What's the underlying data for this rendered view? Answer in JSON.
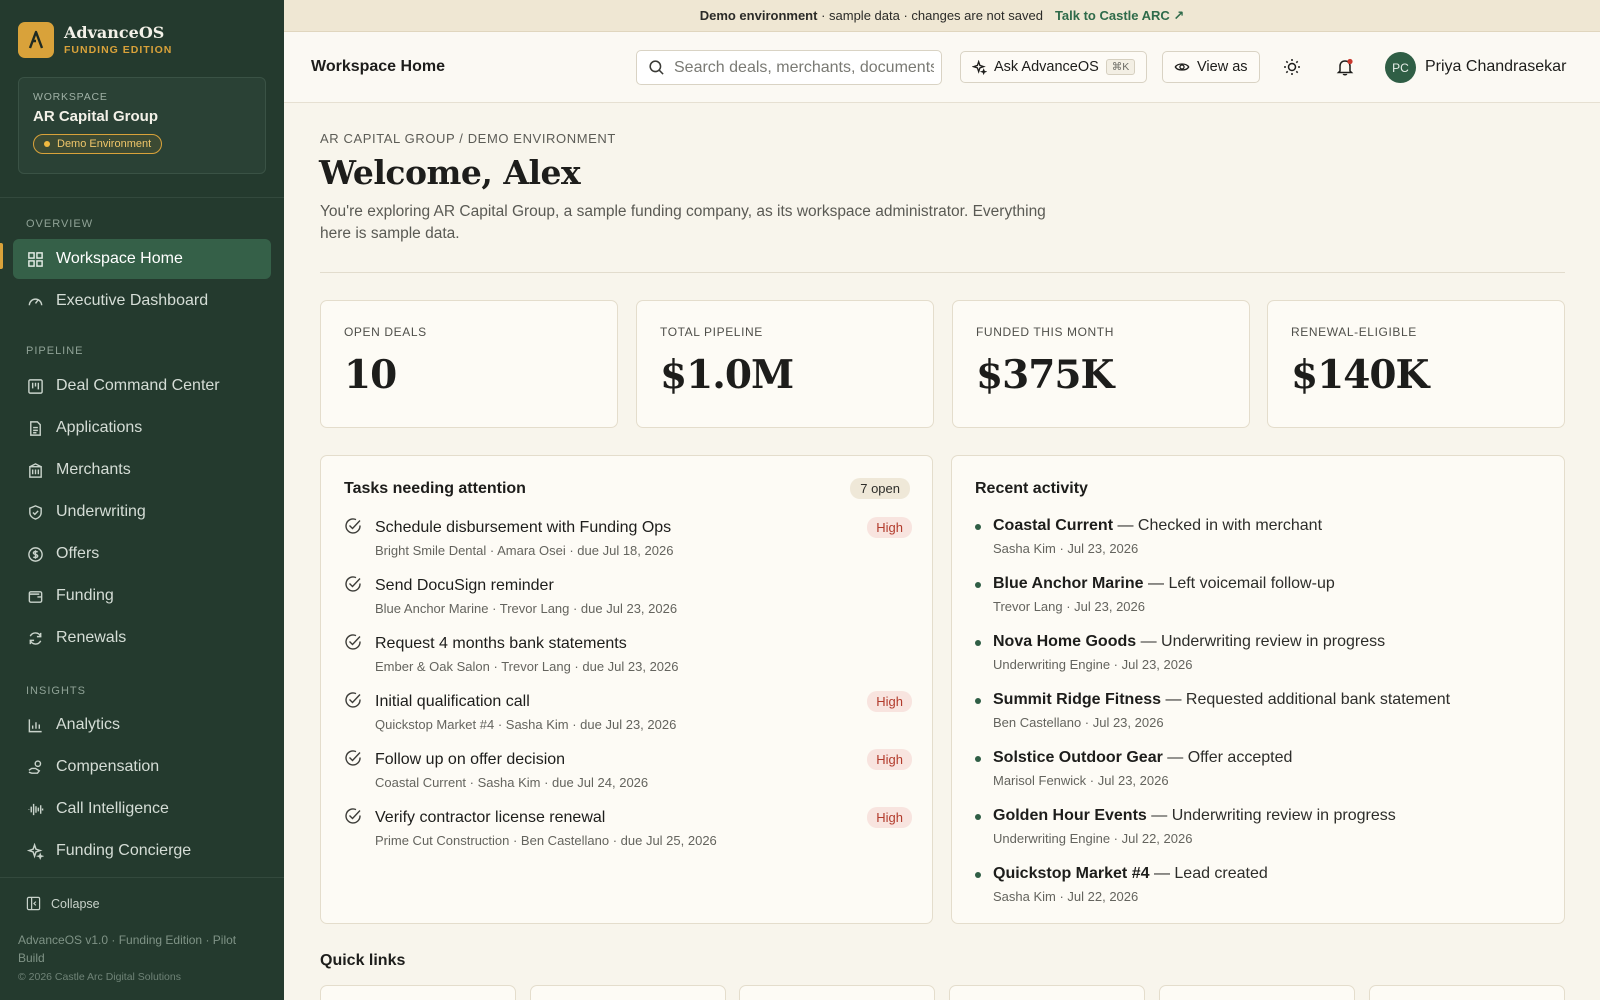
{
  "brand": {
    "name": "AdvanceOS",
    "sub": "FUNDING EDITION"
  },
  "workspace": {
    "label": "WORKSPACE",
    "name": "AR Capital Group",
    "badge": "Demo Environment"
  },
  "nav": {
    "overview_label": "OVERVIEW",
    "pipeline_label": "PIPELINE",
    "insights_label": "INSIGHTS",
    "overview": [
      "Workspace Home",
      "Executive Dashboard"
    ],
    "pipeline": [
      "Deal Command Center",
      "Applications",
      "Merchants",
      "Underwriting",
      "Offers",
      "Funding",
      "Renewals"
    ],
    "insights": [
      "Analytics",
      "Compensation",
      "Call Intelligence",
      "Funding Concierge"
    ],
    "collapse": "Collapse",
    "footer_version": "AdvanceOS v1.0 · Funding Edition · Pilot Build",
    "footer_copyright": "© 2026 Castle Arc Digital Solutions"
  },
  "banner": {
    "bold": "Demo environment",
    "rest": "· sample data · changes are not saved",
    "link": "Talk to Castle ARC ↗"
  },
  "header": {
    "title": "Workspace Home",
    "search_placeholder": "Search deals, merchants, documents",
    "ask_label": "Ask AdvanceOS",
    "ask_kbd": "⌘K",
    "view_as_label": "View as",
    "user_initials": "PC",
    "user_name": "Priya Chandrasekar"
  },
  "main": {
    "breadcrumb": "AR CAPITAL GROUP / DEMO ENVIRONMENT",
    "welcome": "Welcome, Alex",
    "intro": "You're exploring AR Capital Group, a sample funding company, as its workspace administrator. Everything here is sample data."
  },
  "stats": [
    {
      "label": "OPEN DEALS",
      "value": "10"
    },
    {
      "label": "TOTAL PIPELINE",
      "value": "$1.0M"
    },
    {
      "label": "FUNDED THIS MONTH",
      "value": "$375K"
    },
    {
      "label": "RENEWAL-ELIGIBLE",
      "value": "$140K"
    }
  ],
  "tasks": {
    "title": "Tasks needing attention",
    "badge": "7 open",
    "high_label": "High",
    "items": [
      {
        "title": "Schedule disbursement with Funding Ops",
        "meta": "Bright Smile Dental · Amara Osei · due Jul 18, 2026",
        "high": true
      },
      {
        "title": "Send DocuSign reminder",
        "meta": "Blue Anchor Marine · Trevor Lang · due Jul 23, 2026",
        "high": false
      },
      {
        "title": "Request 4 months bank statements",
        "meta": "Ember & Oak Salon · Trevor Lang · due Jul 23, 2026",
        "high": false
      },
      {
        "title": "Initial qualification call",
        "meta": "Quickstop Market #4 · Sasha Kim · due Jul 23, 2026",
        "high": true
      },
      {
        "title": "Follow up on offer decision",
        "meta": "Coastal Current · Sasha Kim · due Jul 24, 2026",
        "high": true
      },
      {
        "title": "Verify contractor license renewal",
        "meta": "Prime Cut Construction · Ben Castellano · due Jul 25, 2026",
        "high": true
      }
    ]
  },
  "activity": {
    "title": "Recent activity",
    "items": [
      {
        "subject": "Coastal Current",
        "action": " — Checked in with merchant",
        "meta": "Sasha Kim · Jul 23, 2026"
      },
      {
        "subject": "Blue Anchor Marine",
        "action": " — Left voicemail follow-up",
        "meta": "Trevor Lang · Jul 23, 2026"
      },
      {
        "subject": "Nova Home Goods",
        "action": " — Underwriting review in progress",
        "meta": "Underwriting Engine · Jul 23, 2026"
      },
      {
        "subject": "Summit Ridge Fitness",
        "action": " — Requested additional bank statement",
        "meta": "Ben Castellano · Jul 23, 2026"
      },
      {
        "subject": "Solstice Outdoor Gear",
        "action": " — Offer accepted",
        "meta": "Marisol Fenwick · Jul 23, 2026"
      },
      {
        "subject": "Golden Hour Events",
        "action": " — Underwriting review in progress",
        "meta": "Underwriting Engine · Jul 22, 2026"
      },
      {
        "subject": "Quickstop Market #4",
        "action": " — Lead created",
        "meta": "Sasha Kim · Jul 22, 2026"
      }
    ]
  },
  "quick_links": {
    "title": "Quick links"
  }
}
